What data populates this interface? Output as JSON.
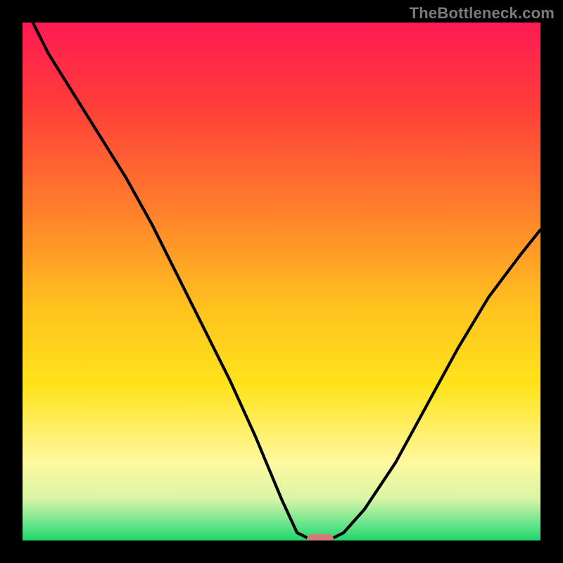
{
  "watermark": "TheBottleneck.com",
  "chart_data": {
    "type": "line",
    "title": "",
    "xlabel": "",
    "ylabel": "",
    "xlim": [
      0,
      1
    ],
    "ylim": [
      0,
      1
    ],
    "x": [
      0.0,
      0.05,
      0.1,
      0.15,
      0.2,
      0.25,
      0.3,
      0.35,
      0.4,
      0.45,
      0.5,
      0.53,
      0.56,
      0.59,
      0.62,
      0.66,
      0.72,
      0.78,
      0.84,
      0.9,
      0.96,
      1.0
    ],
    "values": [
      1.04,
      0.94,
      0.86,
      0.78,
      0.7,
      0.61,
      0.51,
      0.41,
      0.31,
      0.2,
      0.08,
      0.015,
      0.0,
      0.0,
      0.015,
      0.06,
      0.15,
      0.26,
      0.37,
      0.47,
      0.55,
      0.6
    ],
    "minimum_x": 0.575,
    "minimum_y": 0.0
  },
  "marker": {
    "color": "#d47a78"
  },
  "colors": {
    "gradient_top": "#ff1a55",
    "gradient_bottom": "#1fd66b",
    "background": "#000000",
    "curve": "#000000"
  }
}
